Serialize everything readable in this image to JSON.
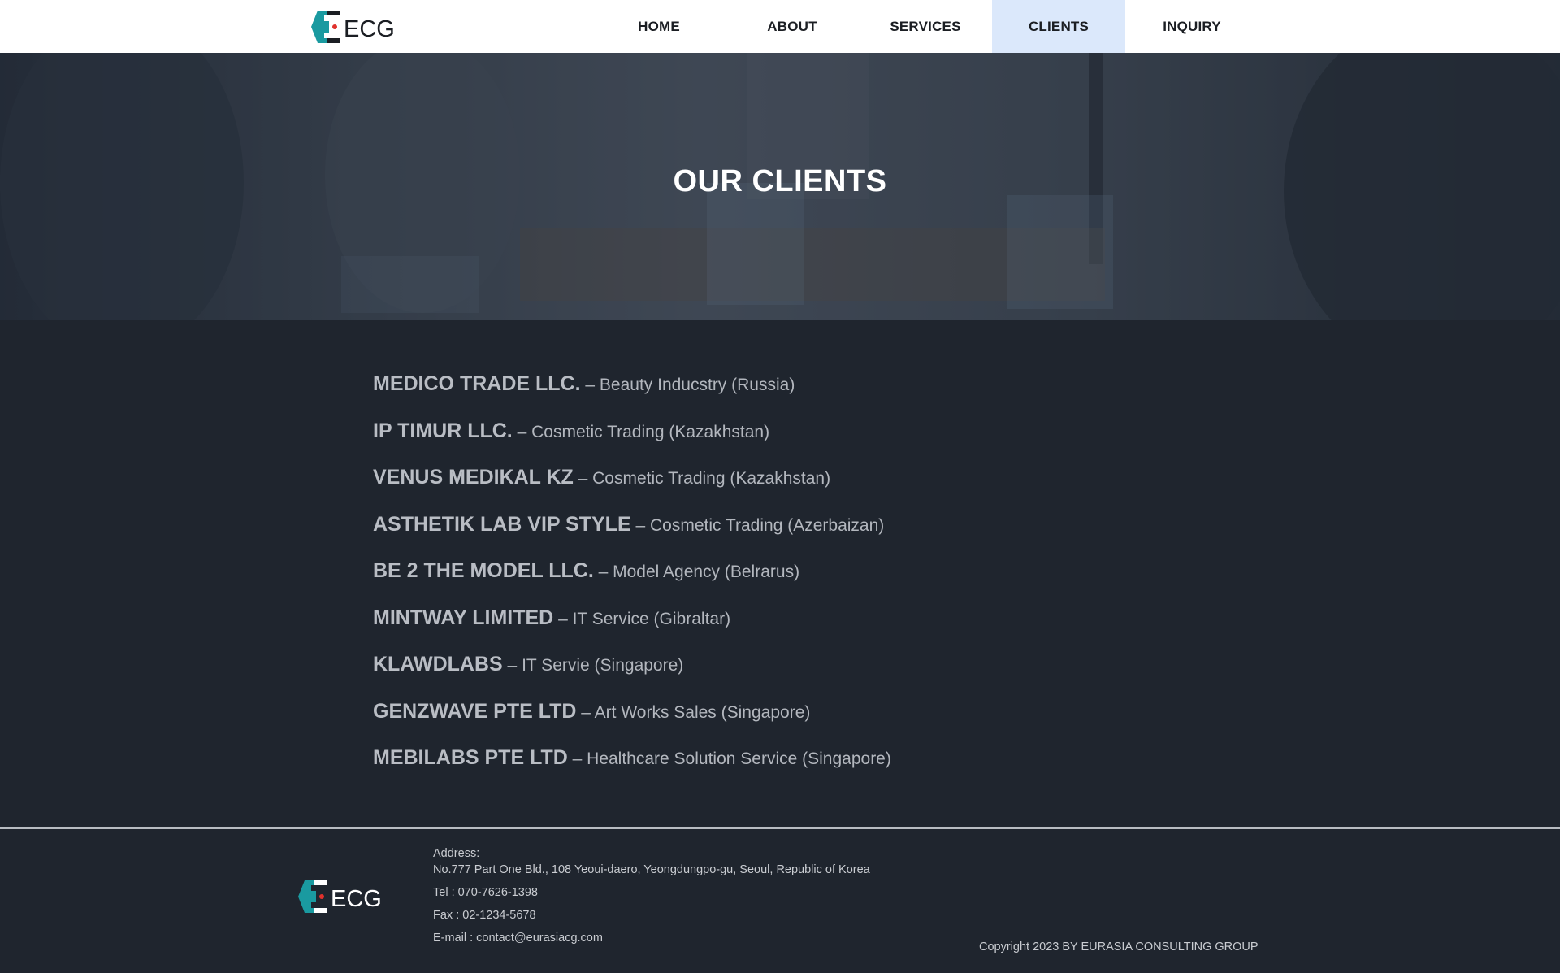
{
  "header": {
    "logo_text": "ECG",
    "nav": [
      {
        "label": "HOME",
        "active": false
      },
      {
        "label": "ABOUT",
        "active": false
      },
      {
        "label": "SERVICES",
        "active": false
      },
      {
        "label": "CLIENTS",
        "active": true
      },
      {
        "label": "INQUIRY",
        "active": false
      }
    ]
  },
  "hero": {
    "title": "OUR CLIENTS"
  },
  "clients": [
    {
      "name": "MEDICO TRADE LLC.",
      "desc": " – Beauty Inducstry (Russia)"
    },
    {
      "name": "IP TIMUR LLC.",
      "desc": " – Cosmetic Trading (Kazakhstan)"
    },
    {
      "name": "VENUS MEDIKAL KZ",
      "desc": " – Cosmetic Trading (Kazakhstan)"
    },
    {
      "name": "ASTHETIK LAB VIP STYLE",
      "desc": " – Cosmetic Trading (Azerbaizan)"
    },
    {
      "name": "BE 2 THE MODEL LLC.",
      "desc": " – Model Agency (Belrarus)"
    },
    {
      "name": "MINTWAY LIMITED",
      "desc": " – IT Service (Gibraltar)"
    },
    {
      "name": "KLAWDLABS",
      "desc": " – IT Servie (Singapore)"
    },
    {
      "name": "GENZWAVE PTE LTD",
      "desc": " – Art Works Sales (Singapore)"
    },
    {
      "name": "MEBILABS PTE LTD",
      "desc": " – Healthcare Solution Service (Singapore)"
    }
  ],
  "footer": {
    "logo_text": "ECG",
    "address_label": "Address:",
    "address": "No.777 Part One Bld., 108 Yeoui-daero, Yeongdungpo-gu, Seoul, Republic of Korea",
    "tel": "Tel : 070-7626-1398",
    "fax": "Fax : 02-1234-5678",
    "email": "E-mail : contact@eurasiacg.com",
    "copyright": "Copyright 2023 BY EURASIA CONSULTING GROUP"
  },
  "colors": {
    "brand_teal": "#1a9aa0",
    "brand_red": "#e0312c",
    "nav_active_bg": "#dbe8fb",
    "page_bg": "#1f252e"
  }
}
